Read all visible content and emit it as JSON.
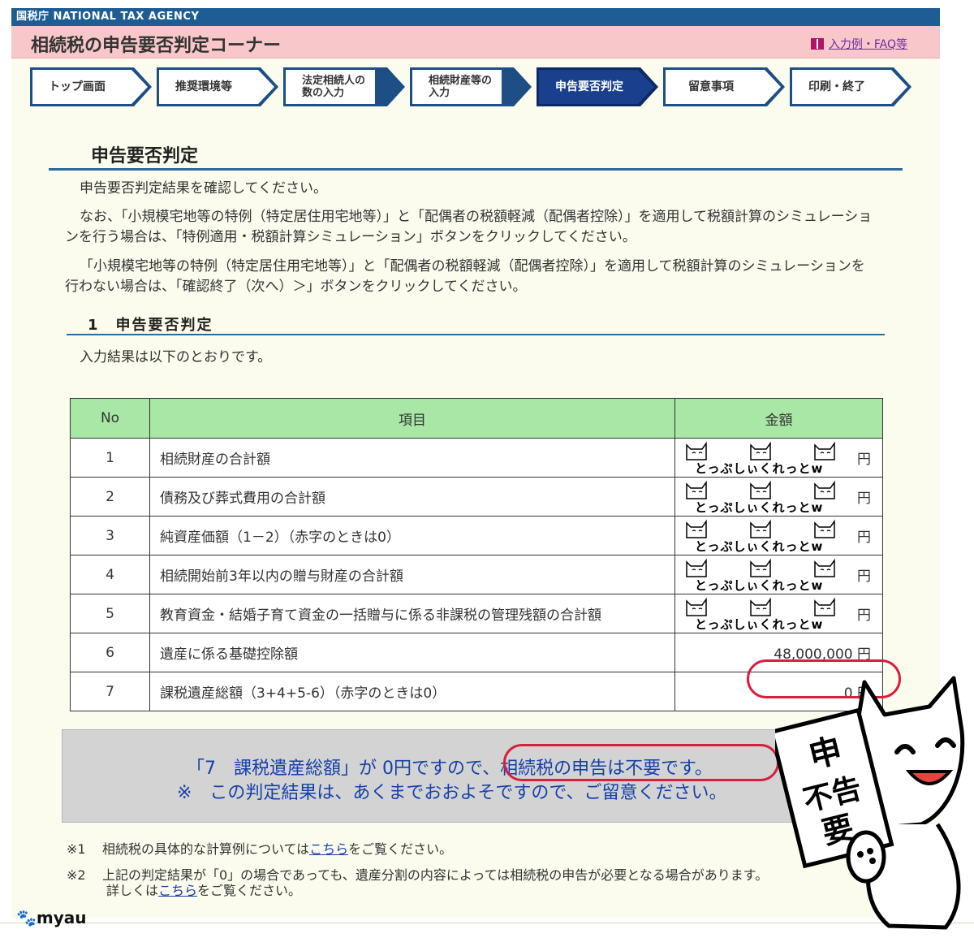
{
  "header": {
    "agency": "国税庁 NATIONAL TAX AGENCY",
    "corner_title": "相続税の申告要否判定コーナー",
    "faq_link": "入力例・FAQ等"
  },
  "steps": [
    {
      "label": "トップ画面",
      "active": false
    },
    {
      "label": "推奨環境等",
      "active": false
    },
    {
      "label": "法定相続人の数の入力",
      "active": false
    },
    {
      "label": "相続財産等の入力",
      "active": false
    },
    {
      "label": "申告要否判定",
      "active": true
    },
    {
      "label": "留意事項",
      "active": false
    },
    {
      "label": "印刷・終了",
      "active": false
    }
  ],
  "section": {
    "title": "申告要否判定",
    "para1": "申告要否判定結果を確認してください。",
    "para2_line1": "なお、「小規模宅地等の特例（特定居住用宅地等）」と「配偶者の税額軽減（配偶者控除）」を適用して税額計算のシミュレーショ",
    "para2_line2": "ンを行う場合は、「特例適用・税額計算シミュレーション」ボタンをクリックしてください。",
    "para3_line1": "「小規模宅地等の特例（特定居住用宅地等）」と「配偶者の税額軽減（配偶者控除）」を適用して税額計算のシミュレーションを",
    "para3_line2": "行わない場合は、「確認終了（次へ）＞」ボタンをクリックしてください。",
    "subtitle": "1　申告要否判定",
    "intro": "入力結果は以下のとおりです。"
  },
  "table": {
    "headers": [
      "No",
      "項目",
      "金額"
    ],
    "mask_caption": "とっぷしぃくれっとw",
    "rows": [
      {
        "no": "1",
        "item": "相続財産の合計額",
        "amount": "",
        "unit": "円"
      },
      {
        "no": "2",
        "item": "債務及び葬式費用の合計額",
        "amount": "",
        "unit": "円"
      },
      {
        "no": "3",
        "item": "純資産価額（1－2）（赤字のときは0）",
        "amount": "",
        "unit": "円"
      },
      {
        "no": "4",
        "item": "相続開始前3年以内の贈与財産の合計額",
        "amount": "",
        "unit": "円"
      },
      {
        "no": "5",
        "item": "教育資金・結婚子育て資金の一括贈与に係る非課税の管理残額の合計額",
        "amount": "",
        "unit": "円"
      },
      {
        "no": "6",
        "item": "遺産に係る基礎控除額",
        "amount": "48,000,000",
        "unit": "円"
      },
      {
        "no": "7",
        "item": "課税遺産総額（3+4+5-6）（赤字のときは0）",
        "amount": "0",
        "unit": "円"
      }
    ]
  },
  "result": {
    "line1": "「7　課税遺産総額」が 0円ですので、相続税の申告は不要です。",
    "line2": "※　この判定結果は、あくまでおおよそですので、ご留意ください。"
  },
  "notes": {
    "n1_mark": "※1",
    "n1_text_a": "相続税の具体的な計算例については",
    "n1_link": "こちら",
    "n1_text_b": "をご覧ください。",
    "n2_mark": "※2",
    "n2_text": "上記の判定結果が「0」の場合であっても、遺産分割の内容によっては相続税の申告が必要となる場合があります。",
    "n2_text_a": "詳しくは",
    "n2_link": "こちら",
    "n2_text_b": "をご覧ください。"
  },
  "sign": {
    "line1": "申",
    "line2": "不告",
    "line3": "要"
  },
  "watermark": "myau",
  "colors": {
    "accent": "#1d5d93",
    "header_pink": "#f7c7c9",
    "table_head": "#a8e7a6",
    "highlight": "#d6203c",
    "result_text": "#1640a9"
  }
}
